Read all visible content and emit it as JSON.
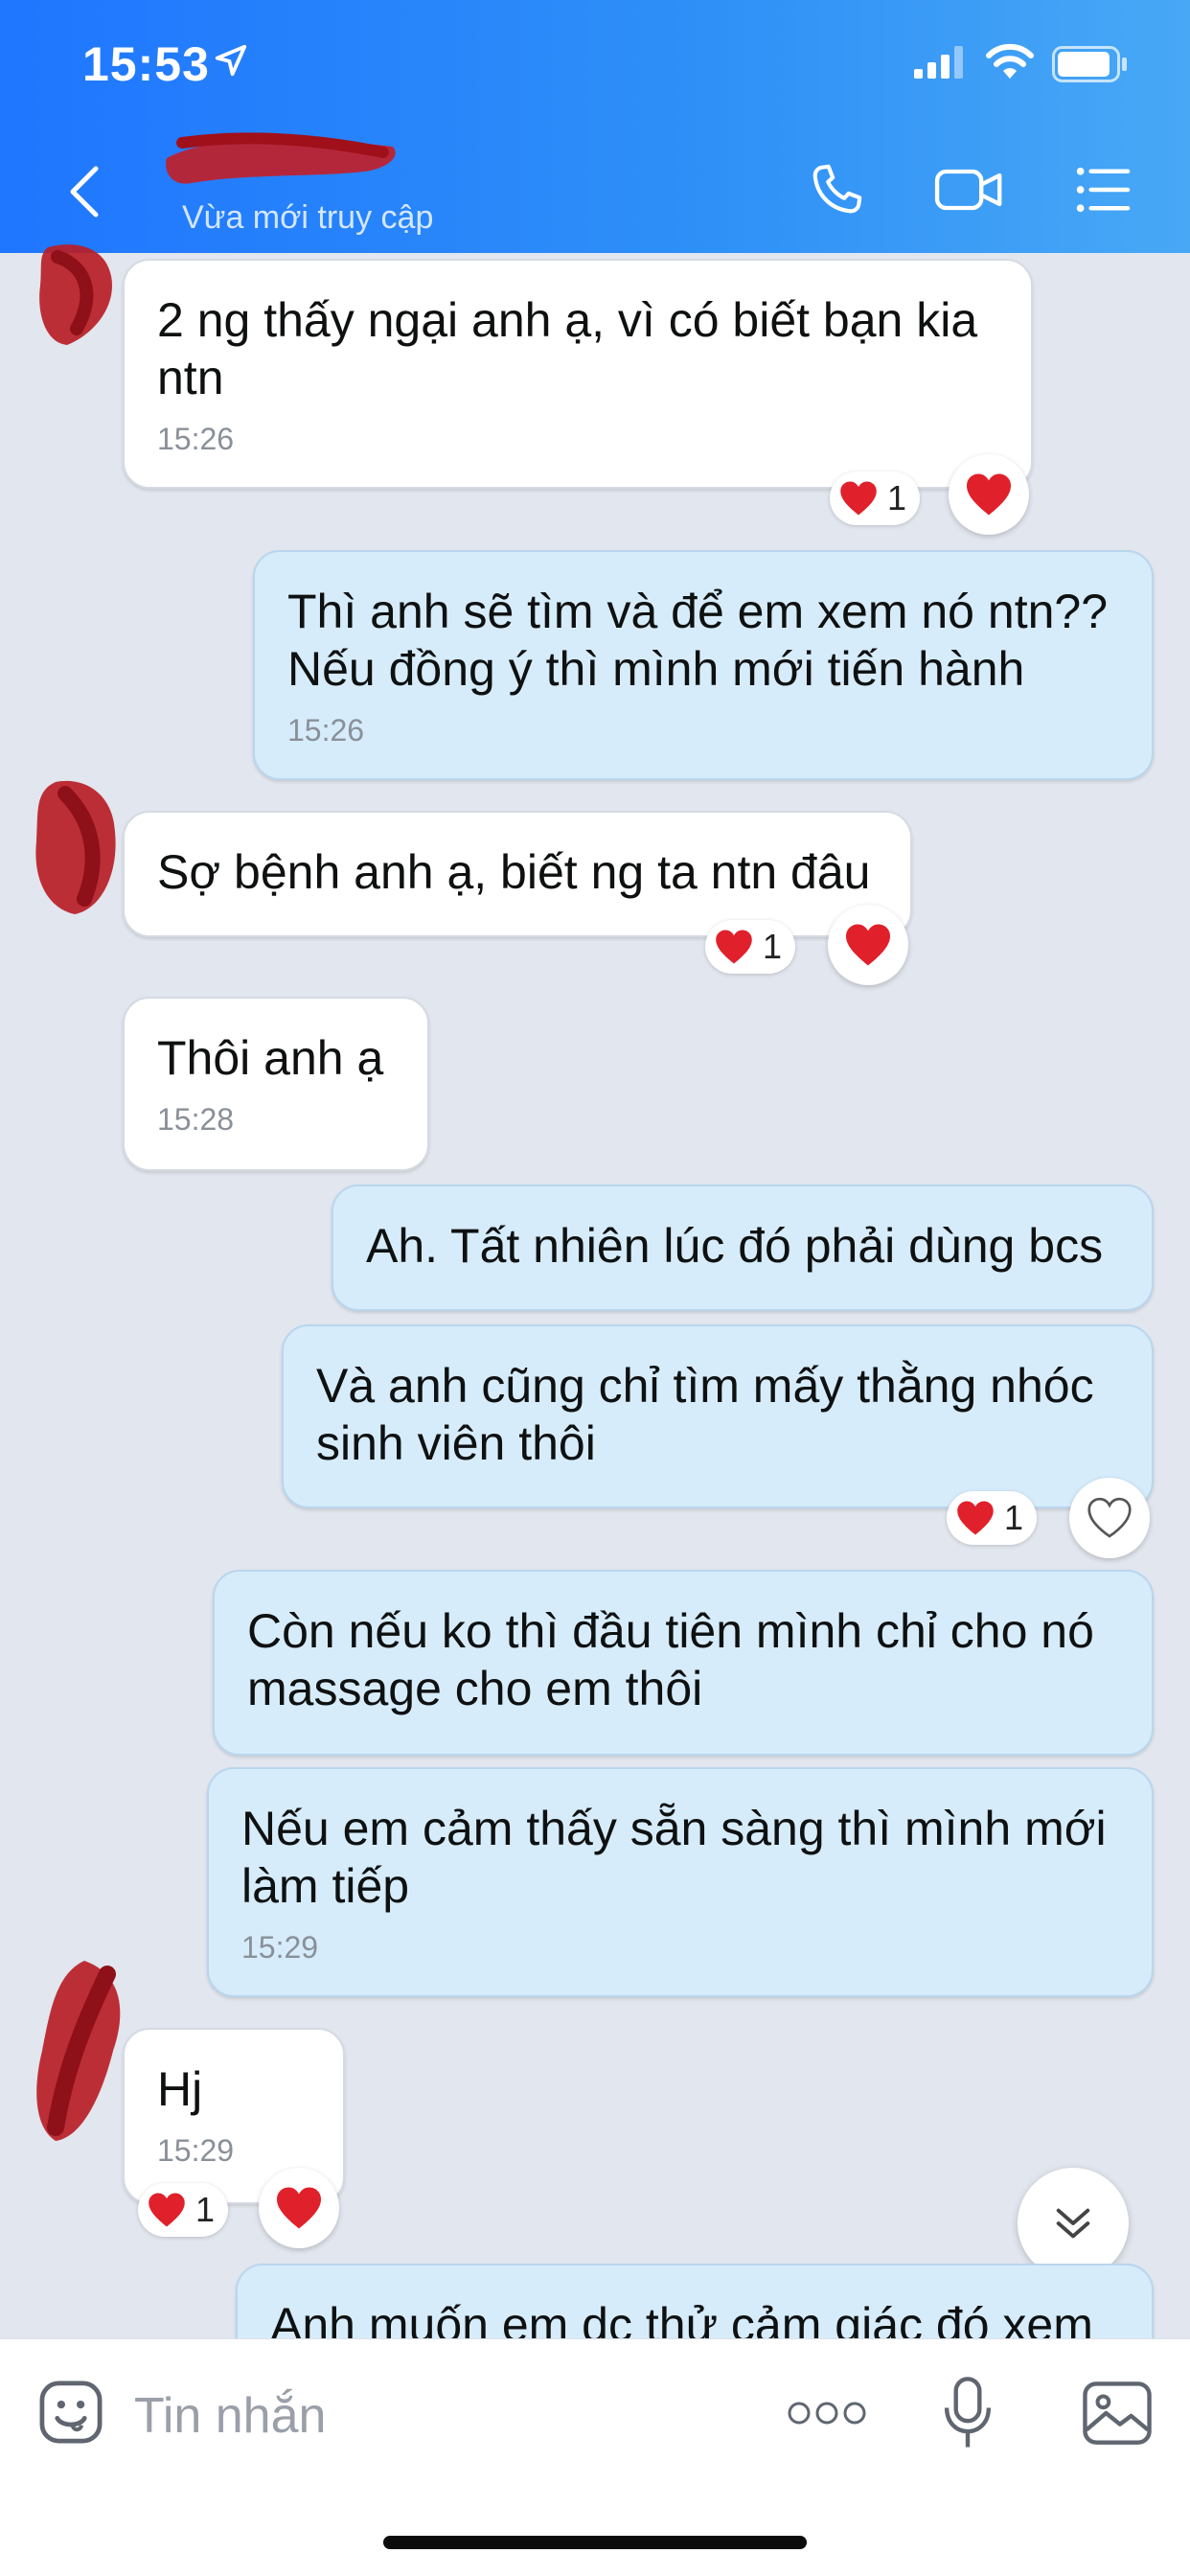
{
  "status_bar": {
    "time": "15:53"
  },
  "header": {
    "contact_status": "Vừa mới truy cập",
    "icons": [
      "back-icon",
      "phone-icon",
      "video-camera-icon",
      "list-menu-icon"
    ]
  },
  "messages": [
    {
      "direction": "received",
      "text": "2 ng thấy ngại anh ạ, vì có biết bạn kia ntn",
      "time": "15:26",
      "reaction_count": "1"
    },
    {
      "direction": "sent",
      "text": "Thì anh sẽ tìm và để em xem nó ntn?? Nếu đồng ý thì mình mới tiến hành",
      "time": "15:26"
    },
    {
      "direction": "received",
      "text": "Sợ bệnh anh ạ, biết ng ta ntn đâu",
      "reaction_count": "1"
    },
    {
      "direction": "received",
      "text": "Thôi anh ạ",
      "time": "15:28"
    },
    {
      "direction": "sent",
      "text": "Ah. Tất nhiên lúc đó phải dùng bcs"
    },
    {
      "direction": "sent",
      "text": "Và anh cũng chỉ tìm mấy thằng nhóc sinh viên thôi",
      "reaction_count": "1"
    },
    {
      "direction": "sent",
      "text": "Còn nếu ko thì đầu tiên mình chỉ cho nó massage cho em thôi"
    },
    {
      "direction": "sent",
      "text": "Nếu em cảm thấy sẵn sàng thì mình mới làm tiếp",
      "time": "15:29"
    },
    {
      "direction": "received",
      "text": "Hj",
      "time": "15:29",
      "reaction_count": "1"
    },
    {
      "direction": "sent",
      "text": "Anh muốn em dc thử cảm giác đó xem"
    }
  ],
  "input_bar": {
    "placeholder": "Tin nhắn",
    "icons": [
      "emoji-icon",
      "more-icon",
      "microphone-icon",
      "image-icon"
    ]
  },
  "colors": {
    "header_start": "#1f76ff",
    "header_end": "#48a8f6",
    "chat_background": "#e2e6ee",
    "sent_bubble": "#d6ecfb",
    "received_bubble": "#ffffff",
    "heart": "#e0202a"
  }
}
